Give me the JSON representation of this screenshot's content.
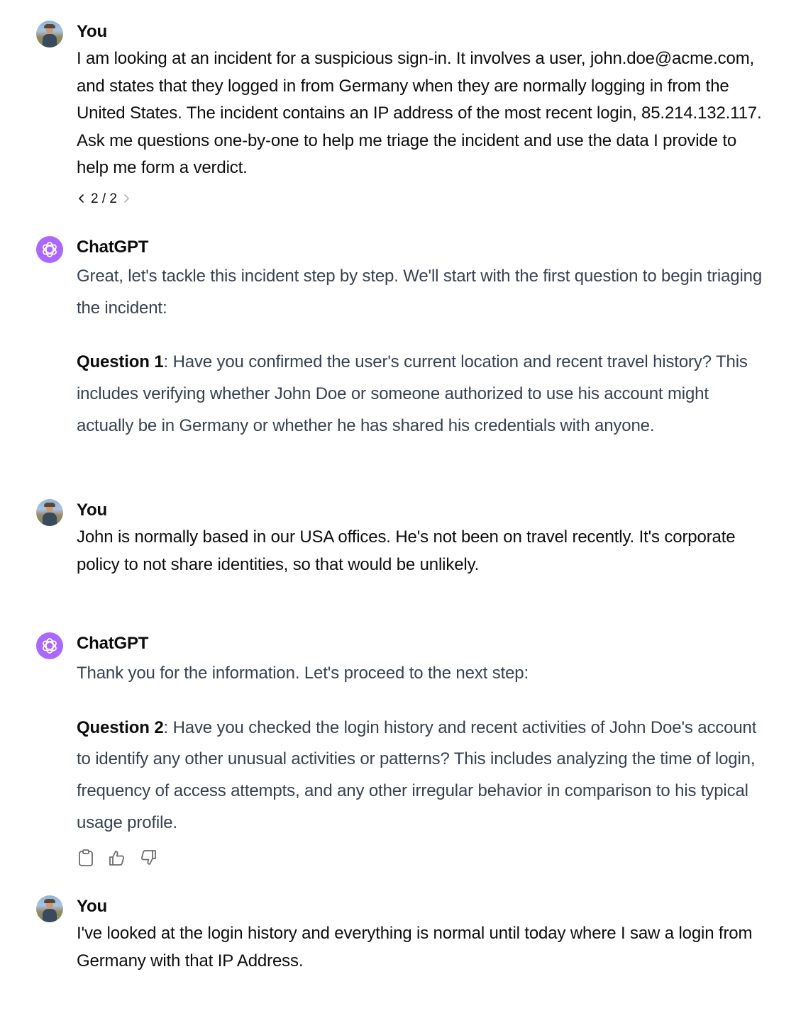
{
  "messages": [
    {
      "author": "You",
      "text": "I am looking at an incident for a suspicious sign-in. It involves a user, john.doe@acme.com, and states that they logged in from Germany when they are normally logging in from the United States. The incident contains an IP address of the most recent login, 85.214.132.117. Ask me questions one-by-one to help me triage the incident and use the data I provide to help me form a verdict.",
      "pager": "2 / 2"
    },
    {
      "author": "ChatGPT",
      "intro": "Great, let's tackle this incident step by step. We'll start with the first question to begin triaging the incident:",
      "question_label": "Question 1",
      "question_text": ": Have you confirmed the user's current location and recent travel history? This includes verifying whether John Doe or someone authorized to use his account might actually be in Germany or whether he has shared his credentials with anyone."
    },
    {
      "author": "You",
      "text": "John is normally based in our USA offices. He's not been on travel recently. It's corporate policy to not share identities, so that would be unlikely."
    },
    {
      "author": "ChatGPT",
      "intro": "Thank you for the information. Let's proceed to the next step:",
      "question_label": "Question 2",
      "question_text": ": Have you checked the login history and recent activities of John Doe's account to identify any other unusual activities or patterns? This includes analyzing the time of login, frequency of access attempts, and any other irregular behavior in comparison to his typical usage profile."
    },
    {
      "author": "You",
      "text": "I've looked at the login history and everything is normal until today where I saw a login from Germany with that IP Address."
    }
  ],
  "icons": {
    "avatar_user": "user-avatar-photo",
    "avatar_gpt": "openai-logo-icon",
    "copy": "clipboard-icon",
    "like": "thumbs-up-icon",
    "dislike": "thumbs-down-icon",
    "prev": "chevron-left-icon",
    "next": "chevron-right-icon"
  },
  "colors": {
    "gpt_avatar": "#ab68ff",
    "assistant_text": "#374151",
    "user_text": "#0d0d0d"
  }
}
